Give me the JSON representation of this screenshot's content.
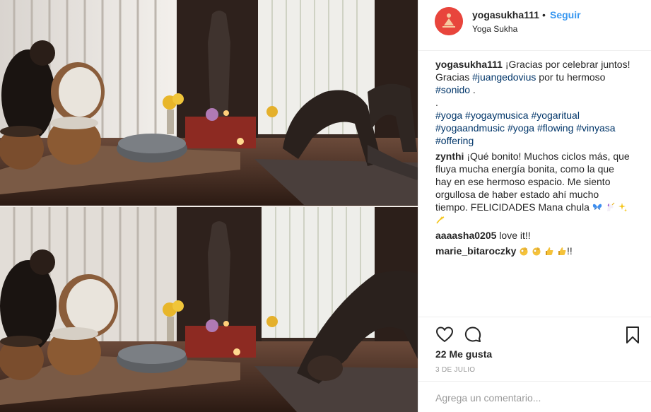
{
  "media": {
    "alt_photo_top": "yoga-class-photo-1",
    "alt_photo_bottom": "yoga-class-photo-2"
  },
  "header": {
    "username": "yogasukha111",
    "separator": "•",
    "follow_label": "Seguir",
    "location": "Yoga Sukha"
  },
  "caption": {
    "username": "yogasukha111",
    "text_1": "¡Gracias por celebrar juntos!",
    "text_2": "Gracias ",
    "mention": "#juangedovius",
    "text_3": " por tu hermoso",
    "tag_sonido": "#sonido",
    "text_4": " .",
    "dot": ".",
    "hashtags": [
      "#yoga",
      "#yogaymusica",
      "#yogaritual",
      "#yogaandmusic",
      "#yoga",
      "#flowing",
      "#vinyasa",
      "#offering"
    ]
  },
  "comments": [
    {
      "username": "zynthi",
      "lines": [
        "¡Qué bonito! Muchos ciclos más, que",
        "fluya mucha energía bonita, como la que",
        "hay en ese hermoso espacio. Me siento",
        "orgullosa de haber estado ahí mucho",
        "tiempo. FELICIDADES Mana chula"
      ],
      "emojis": [
        "butterfly-emoji",
        "unicorn-emoji",
        "sparkles-emoji",
        "dizzy-emoji"
      ]
    },
    {
      "username": "aaaasha0205",
      "text": "love it!!"
    },
    {
      "username": "marie_bitaroczky",
      "emojis": [
        "ok-hand-emoji",
        "ok-hand-emoji",
        "thumbs-up-emoji",
        "thumbs-up-emoji"
      ],
      "text": "!!"
    }
  ],
  "actions": {
    "like_icon": "heart-icon",
    "comment_icon": "comment-bubble-icon",
    "save_icon": "bookmark-icon"
  },
  "likes_text": "22 Me gusta",
  "date_text": "3 DE JULIO",
  "comment_input": {
    "placeholder": "Agrega un comentario...",
    "value": ""
  },
  "colors": {
    "link": "#3897f0",
    "hashtag": "#003569",
    "avatar_bg": "#e8453c",
    "muted": "#999999"
  }
}
